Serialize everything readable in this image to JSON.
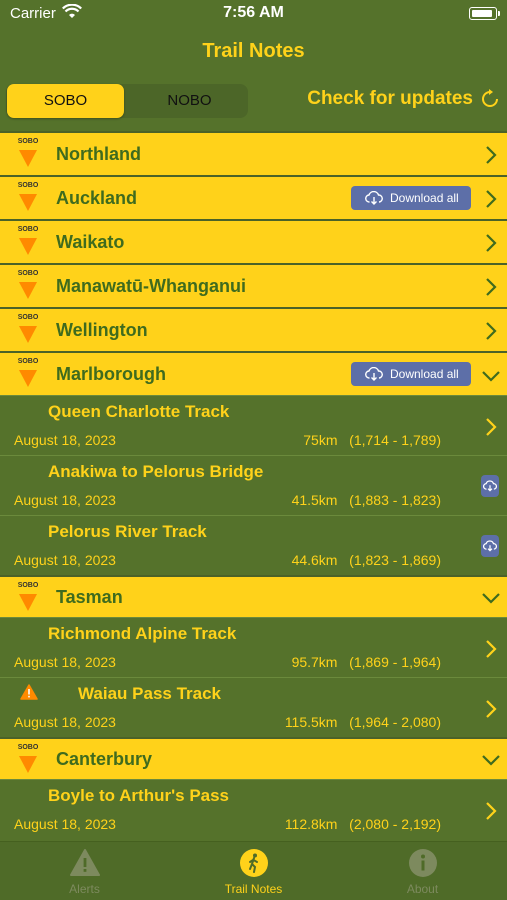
{
  "status": {
    "carrier": "Carrier",
    "time": "7:56 AM"
  },
  "nav": {
    "title": "Trail Notes"
  },
  "toggle": {
    "sobo": "SOBO",
    "nobo": "NOBO",
    "selected": "SOBO"
  },
  "check_updates": "Check for updates",
  "badge_label": "SOBO",
  "download_all": "Download all",
  "regions": [
    {
      "name": "Northland"
    },
    {
      "name": "Auckland"
    },
    {
      "name": "Waikato"
    },
    {
      "name": "Manawatū-Whanganui"
    },
    {
      "name": "Wellington"
    },
    {
      "name": "Marlborough"
    },
    {
      "name": "Tasman"
    },
    {
      "name": "Canterbury"
    }
  ],
  "tracks": [
    {
      "name": "Queen Charlotte Track",
      "date": "August 18, 2023",
      "distance": "75km",
      "range": "(1,714 - 1,789)"
    },
    {
      "name": "Anakiwa to Pelorus Bridge",
      "date": "August 18, 2023",
      "distance": "41.5km",
      "range": "(1,883 - 1,823)"
    },
    {
      "name": "Pelorus River Track",
      "date": "August 18, 2023",
      "distance": "44.6km",
      "range": "(1,823 - 1,869)"
    },
    {
      "name": "Richmond Alpine Track",
      "date": "August 18, 2023",
      "distance": "95.7km",
      "range": "(1,869 - 1,964)"
    },
    {
      "name": "Waiau Pass Track",
      "date": "August 18, 2023",
      "distance": "115.5km",
      "range": "(1,964 - 2,080)"
    },
    {
      "name": "Boyle to Arthur's Pass",
      "date": "August 18, 2023",
      "distance": "112.8km",
      "range": "(2,080 - 2,192)"
    }
  ],
  "tabs": {
    "alerts": "Alerts",
    "trail_notes": "Trail Notes",
    "about": "About"
  },
  "colors": {
    "accent": "#ffd21a",
    "background": "#55722b",
    "button": "#5d6fa8"
  }
}
